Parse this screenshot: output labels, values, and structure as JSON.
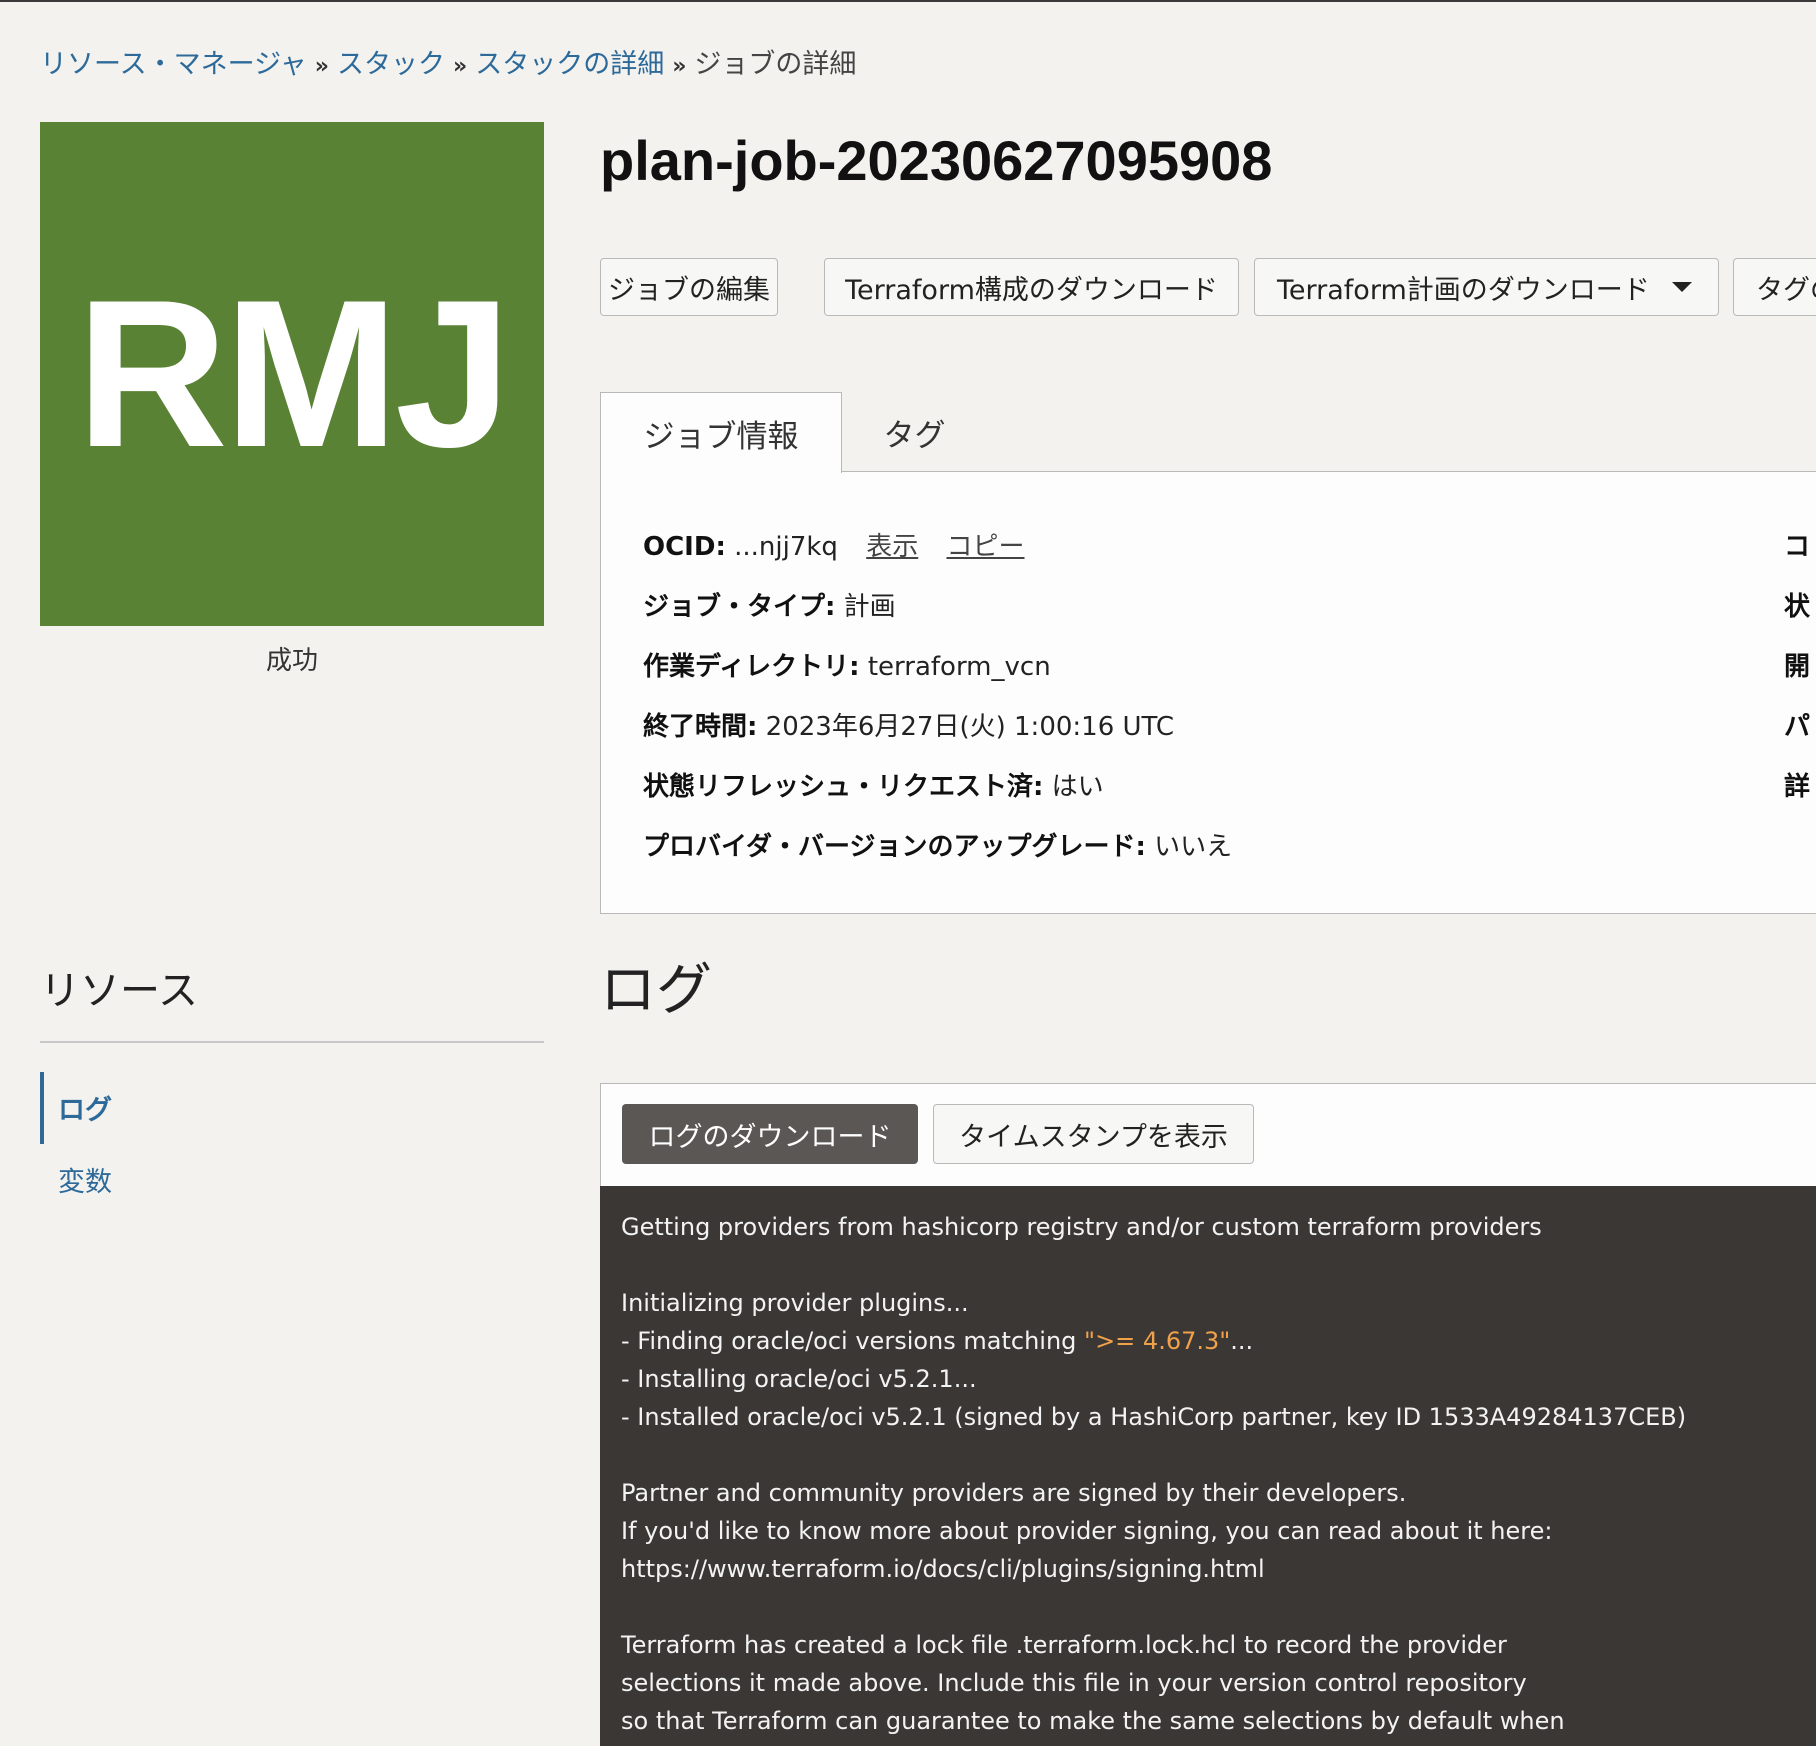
{
  "breadcrumb": {
    "items": [
      "リソース・マネージャ",
      "スタック",
      "スタックの詳細"
    ],
    "separator": "»",
    "current": "ジョブの詳細"
  },
  "status_tile": {
    "abbr": "RMJ",
    "status": "成功",
    "color": "#5a8234"
  },
  "job": {
    "title": "plan-job-20230627095908"
  },
  "actions": {
    "edit": "ジョブの編集",
    "download_config": "Terraform構成のダウンロード",
    "download_plan": "Terraform計画のダウンロード",
    "tags_partial": "タグの"
  },
  "tabs": {
    "job_info": "ジョブ情報",
    "tags": "タグ"
  },
  "job_info": {
    "ocid_label": "OCID:",
    "ocid_value": "...njj7kq",
    "show_link": "表示",
    "copy_link": "コピー",
    "job_type_label": "ジョブ・タイプ:",
    "job_type_value": "計画",
    "workdir_label": "作業ディレクトリ:",
    "workdir_value": "terraform_vcn",
    "end_time_label": "終了時間:",
    "end_time_value": "2023年6月27日(火) 1:00:16 UTC",
    "refresh_label": "状態リフレッシュ・リクエスト済:",
    "refresh_value": "はい",
    "upgrade_label": "プロバイダ・バージョンのアップグレード:",
    "upgrade_value": "いいえ",
    "right_col_partial": [
      "コ",
      "状",
      "開",
      "パ",
      "詳"
    ]
  },
  "resources": {
    "heading": "リソース",
    "items": [
      {
        "label": "ログ",
        "active": true
      },
      {
        "label": "変数",
        "active": false
      }
    ]
  },
  "logs": {
    "heading": "ログ",
    "download_button": "ログのダウンロード",
    "timestamp_button": "タイムスタンプを表示",
    "lines": [
      "Getting providers from hashicorp registry and/or custom terraform providers",
      "",
      "Initializing provider plugins...",
      "- Finding oracle/oci versions matching ",
      "- Installing oracle/oci v5.2.1...",
      "- Installed oracle/oci v5.2.1 (signed by a HashiCorp partner, key ID 1533A49284137CEB)",
      "",
      "Partner and community providers are signed by their developers.",
      "If you'd like to know more about provider signing, you can read about it here:",
      "https://www.terraform.io/docs/cli/plugins/signing.html",
      "",
      "Terraform has created a lock file .terraform.lock.hcl to record the provider",
      "selections it made above. Include this file in your version control repository",
      "so that Terraform can guarantee to make the same selections by default when"
    ],
    "version_constraint": "\">= 4.67.3\"",
    "line4_suffix": "...",
    "highlight_color": "#f0a14a"
  }
}
